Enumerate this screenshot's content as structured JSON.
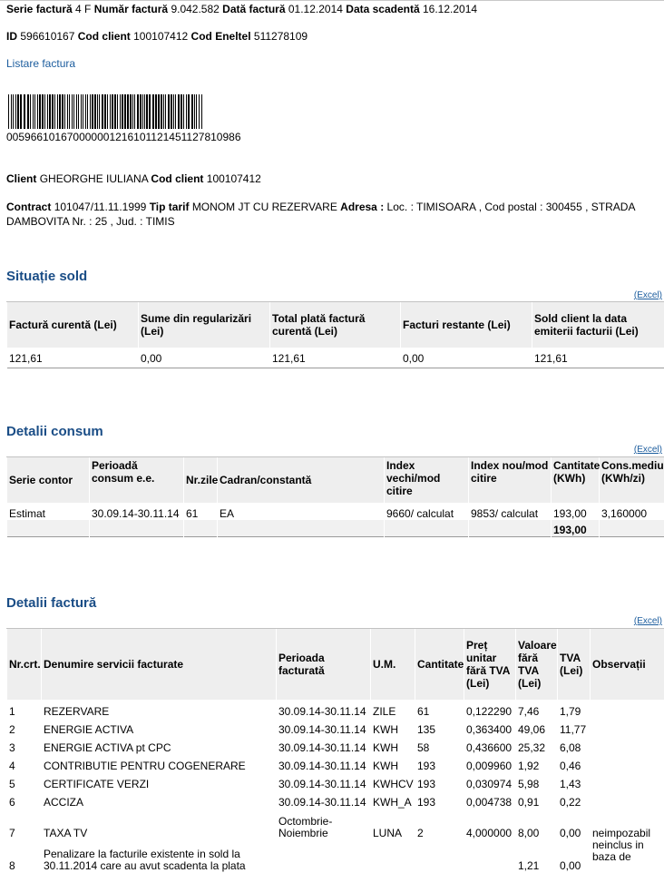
{
  "header": {
    "serie_label": "Serie factură",
    "serie_value": "4 F",
    "numar_label": "Număr factură",
    "numar_value": "9.042.582",
    "data_label": "Dată factură",
    "data_value": "01.12.2014",
    "scadenta_label": "Data scadentă",
    "scadenta_value": "16.12.2014",
    "id_label": "ID",
    "id_value": "596610167",
    "cod_client_label": "Cod client",
    "cod_client_value": "100107412",
    "cod_eneltel_label": "Cod Eneltel",
    "cod_eneltel_value": "511278109",
    "listare_link": "Listare factura"
  },
  "barcode": {
    "digits": "005966101670000001216101121451127810986"
  },
  "client": {
    "client_label": "Client",
    "client_name": "GHEORGHE IULIANA",
    "cod_client_label": "Cod client",
    "cod_client_value": "100107412",
    "contract_label": "Contract",
    "contract_value": "101047/11.11.1999",
    "tip_tarif_label": "Tip tarif",
    "tip_tarif_value": "MONOM JT CU REZERVARE",
    "adresa_label": "Adresa :",
    "adresa_value": "Loc. : TIMISOARA , Cod postal : 300455 , STRADA DAMBOVITA Nr. : 25 , Jud. : TIMIS"
  },
  "sold": {
    "title": "Situație sold",
    "excel": "(Excel)",
    "headers": [
      "Factură curentă (Lei)",
      "Sume din regularizări (Lei)",
      "Total plată factură curentă (Lei)",
      "Facturi restante (Lei)",
      "Sold client la data emiterii facturii (Lei)"
    ],
    "row": [
      "121,61",
      "0,00",
      "121,61",
      "0,00",
      "121,61"
    ]
  },
  "consum": {
    "title": "Detalii consum",
    "excel": "(Excel)",
    "headers": [
      "Serie contor",
      "Perioadă consum e.e.",
      "Nr.zile",
      "Cadran/constantă",
      "Index vechi/mod citire",
      "Index nou/mod citire",
      "Cantitate (KWh)",
      "Cons.mediu (KWh/zi)"
    ],
    "row": [
      "Estimat",
      "30.09.14-30.11.14",
      "61",
      "EA",
      "9660/ calculat",
      "9853/ calculat",
      "193,00",
      "3,160000"
    ],
    "total": "193,00"
  },
  "factura": {
    "title": "Detalii factură",
    "excel": "(Excel)",
    "headers": [
      "Nr.crt.",
      "Denumire servicii facturate",
      "Perioada facturată",
      "U.M.",
      "Cantitate",
      "Preț unitar fără TVA (Lei)",
      "Valoare fără TVA (Lei)",
      "TVA (Lei)",
      "Observații"
    ],
    "rows": [
      [
        "1",
        "REZERVARE",
        "30.09.14-30.11.14",
        "ZILE",
        "61",
        "0,122290",
        "7,46",
        "1,79",
        ""
      ],
      [
        "2",
        "ENERGIE ACTIVA",
        "30.09.14-30.11.14",
        "KWH",
        "135",
        "0,363400",
        "49,06",
        "11,77",
        ""
      ],
      [
        "3",
        "ENERGIE ACTIVA pt CPC",
        "30.09.14-30.11.14",
        "KWH",
        "58",
        "0,436600",
        "25,32",
        "6,08",
        ""
      ],
      [
        "4",
        "CONTRIBUTIE PENTRU COGENERARE",
        "30.09.14-30.11.14",
        "KWH",
        "193",
        "0,009960",
        "1,92",
        "0,46",
        ""
      ],
      [
        "5",
        "CERTIFICATE VERZI",
        "30.09.14-30.11.14",
        "KWHCV",
        "193",
        "0,030974",
        "5,98",
        "1,43",
        ""
      ],
      [
        "6",
        "ACCIZA",
        "30.09.14-30.11.14",
        "KWH_A",
        "193",
        "0,004738",
        "0,91",
        "0,22",
        ""
      ],
      [
        "7",
        "TAXA TV",
        "Octombrie-Noiembrie",
        "LUNA",
        "2",
        "4,000000",
        "8,00",
        "0,00",
        "neimpozabil"
      ],
      [
        "8",
        "Penalizare la facturile existente in sold la 30.11.2014 care au avut scadenta la plata",
        "",
        "",
        "",
        "",
        "1,21",
        "0,00",
        "neinclus in baza de"
      ]
    ]
  },
  "colors": {
    "section_title": "#1a4d86",
    "link": "#1c5d9e",
    "header_bg": "#eeeeee"
  }
}
